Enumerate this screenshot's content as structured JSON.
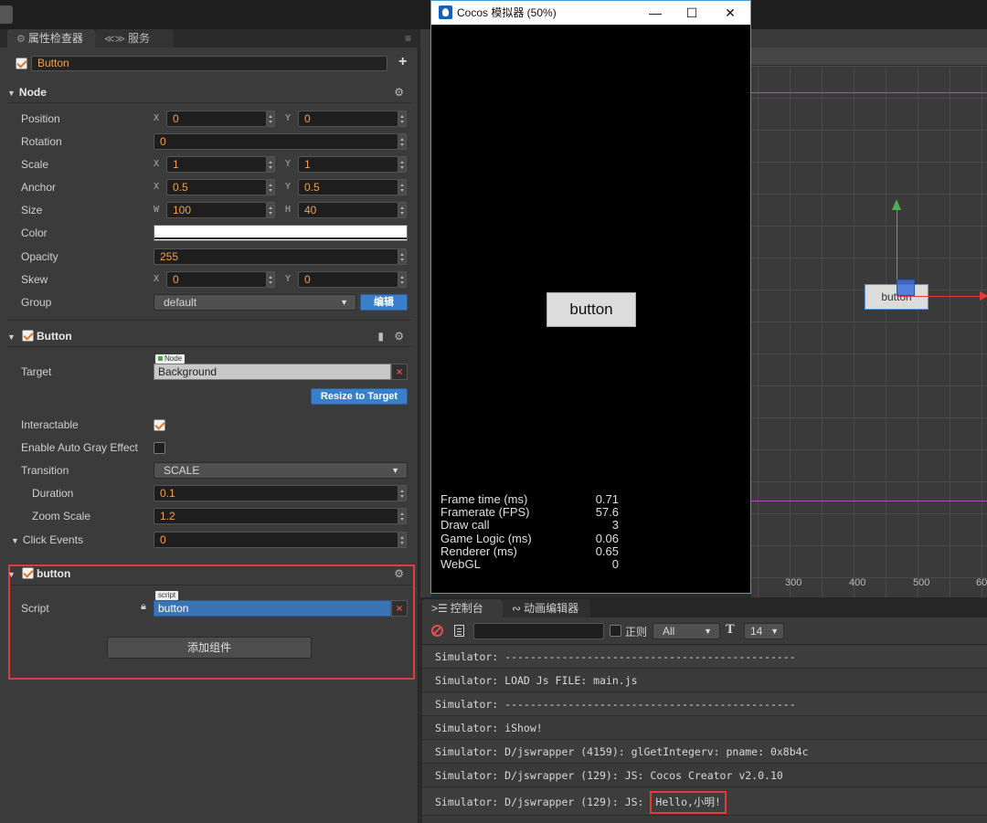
{
  "inspector": {
    "tabs": [
      {
        "label": "属性检查器",
        "icon": "gear-icon"
      },
      {
        "label": "服务",
        "icon": "code-icon"
      }
    ],
    "node_name": "Button",
    "node_section": {
      "title": "Node",
      "rows": {
        "position": {
          "label": "Position",
          "x": "0",
          "y": "0"
        },
        "rotation": {
          "label": "Rotation",
          "value": "0"
        },
        "scale": {
          "label": "Scale",
          "x": "1",
          "y": "1"
        },
        "anchor": {
          "label": "Anchor",
          "x": "0.5",
          "y": "0.5"
        },
        "size": {
          "label": "Size",
          "w": "100",
          "h": "40"
        },
        "color": {
          "label": "Color",
          "value": "#ffffff"
        },
        "opacity": {
          "label": "Opacity",
          "value": "255"
        },
        "skew": {
          "label": "Skew",
          "x": "0",
          "y": "0"
        },
        "group": {
          "label": "Group",
          "value": "default",
          "edit_label": "编辑"
        }
      },
      "axis_labels": {
        "x": "X",
        "y": "Y",
        "w": "W",
        "h": "H"
      }
    },
    "button_component": {
      "title": "Button",
      "target": {
        "label": "Target",
        "tag": "Node",
        "value": "Background"
      },
      "resize_label": "Resize to Target",
      "interactable": {
        "label": "Interactable",
        "checked": true
      },
      "auto_gray": {
        "label": "Enable Auto Gray Effect",
        "checked": false
      },
      "transition": {
        "label": "Transition",
        "value": "SCALE"
      },
      "duration": {
        "label": "Duration",
        "value": "0.1"
      },
      "zoom_scale": {
        "label": "Zoom Scale",
        "value": "1.2"
      },
      "click_events": {
        "label": "Click Events",
        "value": "0"
      }
    },
    "script_component": {
      "title": "button",
      "script": {
        "label": "Script",
        "tag": "script",
        "value": "button"
      },
      "add_component_label": "添加组件"
    }
  },
  "simulator": {
    "title": "Cocos 模拟器 (50%)",
    "button_text": "button",
    "stats": [
      {
        "label": "Frame time (ms)",
        "value": "0.71"
      },
      {
        "label": "Framerate (FPS)",
        "value": "57.6"
      },
      {
        "label": "Draw call",
        "value": "3"
      },
      {
        "label": "Game Logic (ms)",
        "value": "0.06"
      },
      {
        "label": "Renderer (ms)",
        "value": "0.65"
      },
      {
        "label": "WebGL",
        "value": "0"
      }
    ]
  },
  "scene": {
    "node_label": "button",
    "ruler": [
      "300",
      "400",
      "500",
      "60"
    ]
  },
  "console": {
    "tabs": [
      {
        "label": "控制台",
        "icon": "console-icon"
      },
      {
        "label": "动画编辑器",
        "icon": "animation-icon"
      }
    ],
    "regex_label": "正则",
    "level": "All",
    "font_size": "14",
    "logs": [
      "Simulator: ----------------------------------------------",
      "Simulator: LOAD Js FILE: main.js",
      "Simulator: ----------------------------------------------",
      "Simulator: iShow!",
      "Simulator: D/jswrapper (4159): glGetIntegerv: pname: 0x8b4c",
      "Simulator: D/jswrapper (129): JS: Cocos Creator v2.0.10"
    ],
    "last_log_prefix": "Simulator: D/jswrapper (129): JS:",
    "last_log_highlight": "Hello,小明!"
  }
}
